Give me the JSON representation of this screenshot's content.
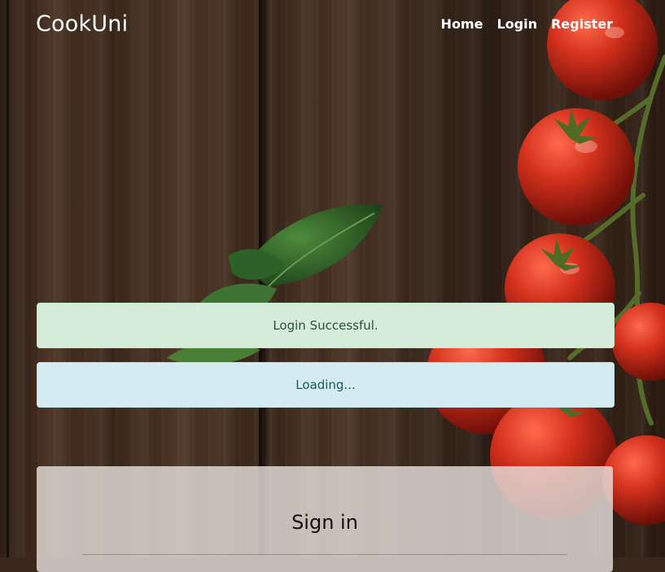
{
  "header": {
    "brand": "CookUni",
    "nav": {
      "home": "Home",
      "login": "Login",
      "register": "Register"
    }
  },
  "alerts": {
    "success": "Login Successful.",
    "info": "Loading..."
  },
  "signin": {
    "title": "Sign in"
  },
  "colors": {
    "success_bg": "#d5ecda",
    "info_bg": "#d3ebf1",
    "tomato": "#c8261a",
    "basil": "#2f6a2a"
  }
}
